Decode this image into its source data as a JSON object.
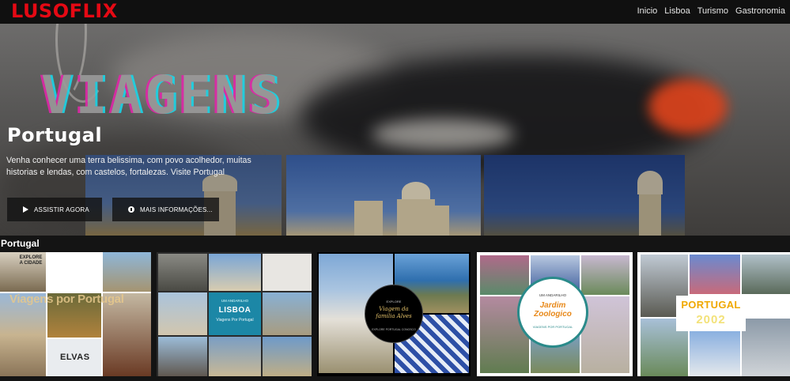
{
  "brand": {
    "logo": "LUSOFLIX",
    "color": "#e50914"
  },
  "nav": [
    "Inicio",
    "Lisboa",
    "Turismo",
    "Gastronomia"
  ],
  "hero": {
    "banner_text": "VIAGENS",
    "title": "Portugal",
    "description": "Venha conhecer uma terra belissima, com povo acolhedor, muitas historias e lendas, com castelos, fortalezas. Visite Portugal",
    "buttons": {
      "play": "ASSISTIR AGORA",
      "info": "MAIS INFORMAÇÕES..."
    }
  },
  "row": {
    "title": "Portugal",
    "cards": [
      {
        "name": "elvas",
        "top_label": "EXPLORE A CIDADE",
        "overlay": "Viagens por Portugal",
        "caption": "ELVAS"
      },
      {
        "name": "lisboa",
        "kicker": "UM ANDARILHO",
        "title": "LISBOA",
        "subtitle": "Viagens Por Portugal"
      },
      {
        "name": "familia-alves",
        "kicker": "EXPLORE",
        "title": "Viagem da familia Alves",
        "subtitle": "EXPLORE PORTUGAL CONOSCO"
      },
      {
        "name": "jardim-zoologico",
        "kicker": "UM ANDARILHO",
        "title": "Jardim Zoologico",
        "subtitle": "VIAGENS POR PORTUGAL"
      },
      {
        "name": "portugal-2002",
        "title": "PORTUGAL",
        "year": "2002"
      }
    ]
  }
}
